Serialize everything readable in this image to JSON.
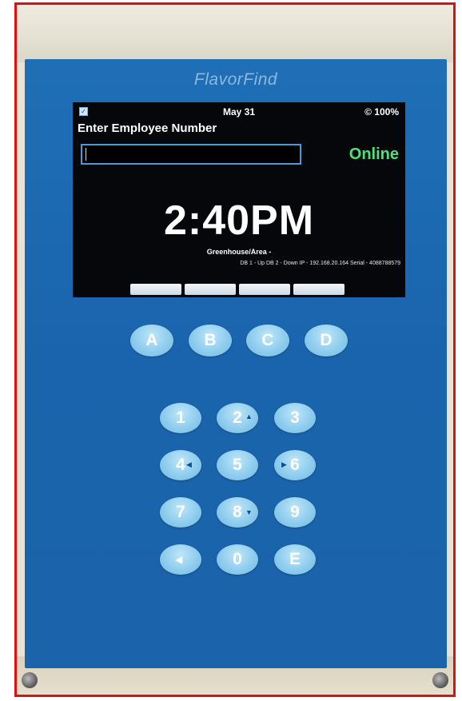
{
  "device": {
    "brand": "FlavorFind"
  },
  "screen": {
    "status_date": "May 31",
    "status_battery": "© 100%",
    "prompt": "Enter Employee Number",
    "employee_input_value": "",
    "connection_status": "Online",
    "time": "2:40PM",
    "area": "Greenhouse/Area -",
    "network_info": "DB 1 - Up  DB 2 - Down  IP - 192.168.20.164  Serial - 4088788579",
    "softkeys": [
      "",
      "",
      "",
      ""
    ]
  },
  "keypad": {
    "letters": [
      "A",
      "B",
      "C",
      "D"
    ],
    "digits": [
      "1",
      "2",
      "3",
      "4",
      "5",
      "6",
      "7",
      "8",
      "9",
      "",
      "0",
      "E"
    ],
    "icons": {
      "key_2": "arrow-up-icon",
      "key_4": "arrow-left-icon",
      "key_6": "arrow-right-icon",
      "key_8": "arrow-down-icon",
      "backspace": "backspace-arrow-icon"
    }
  },
  "colors": {
    "panel": "#1f6fb6",
    "online": "#4fe07a",
    "key": "#8fcdee",
    "frame": "#e01010"
  }
}
